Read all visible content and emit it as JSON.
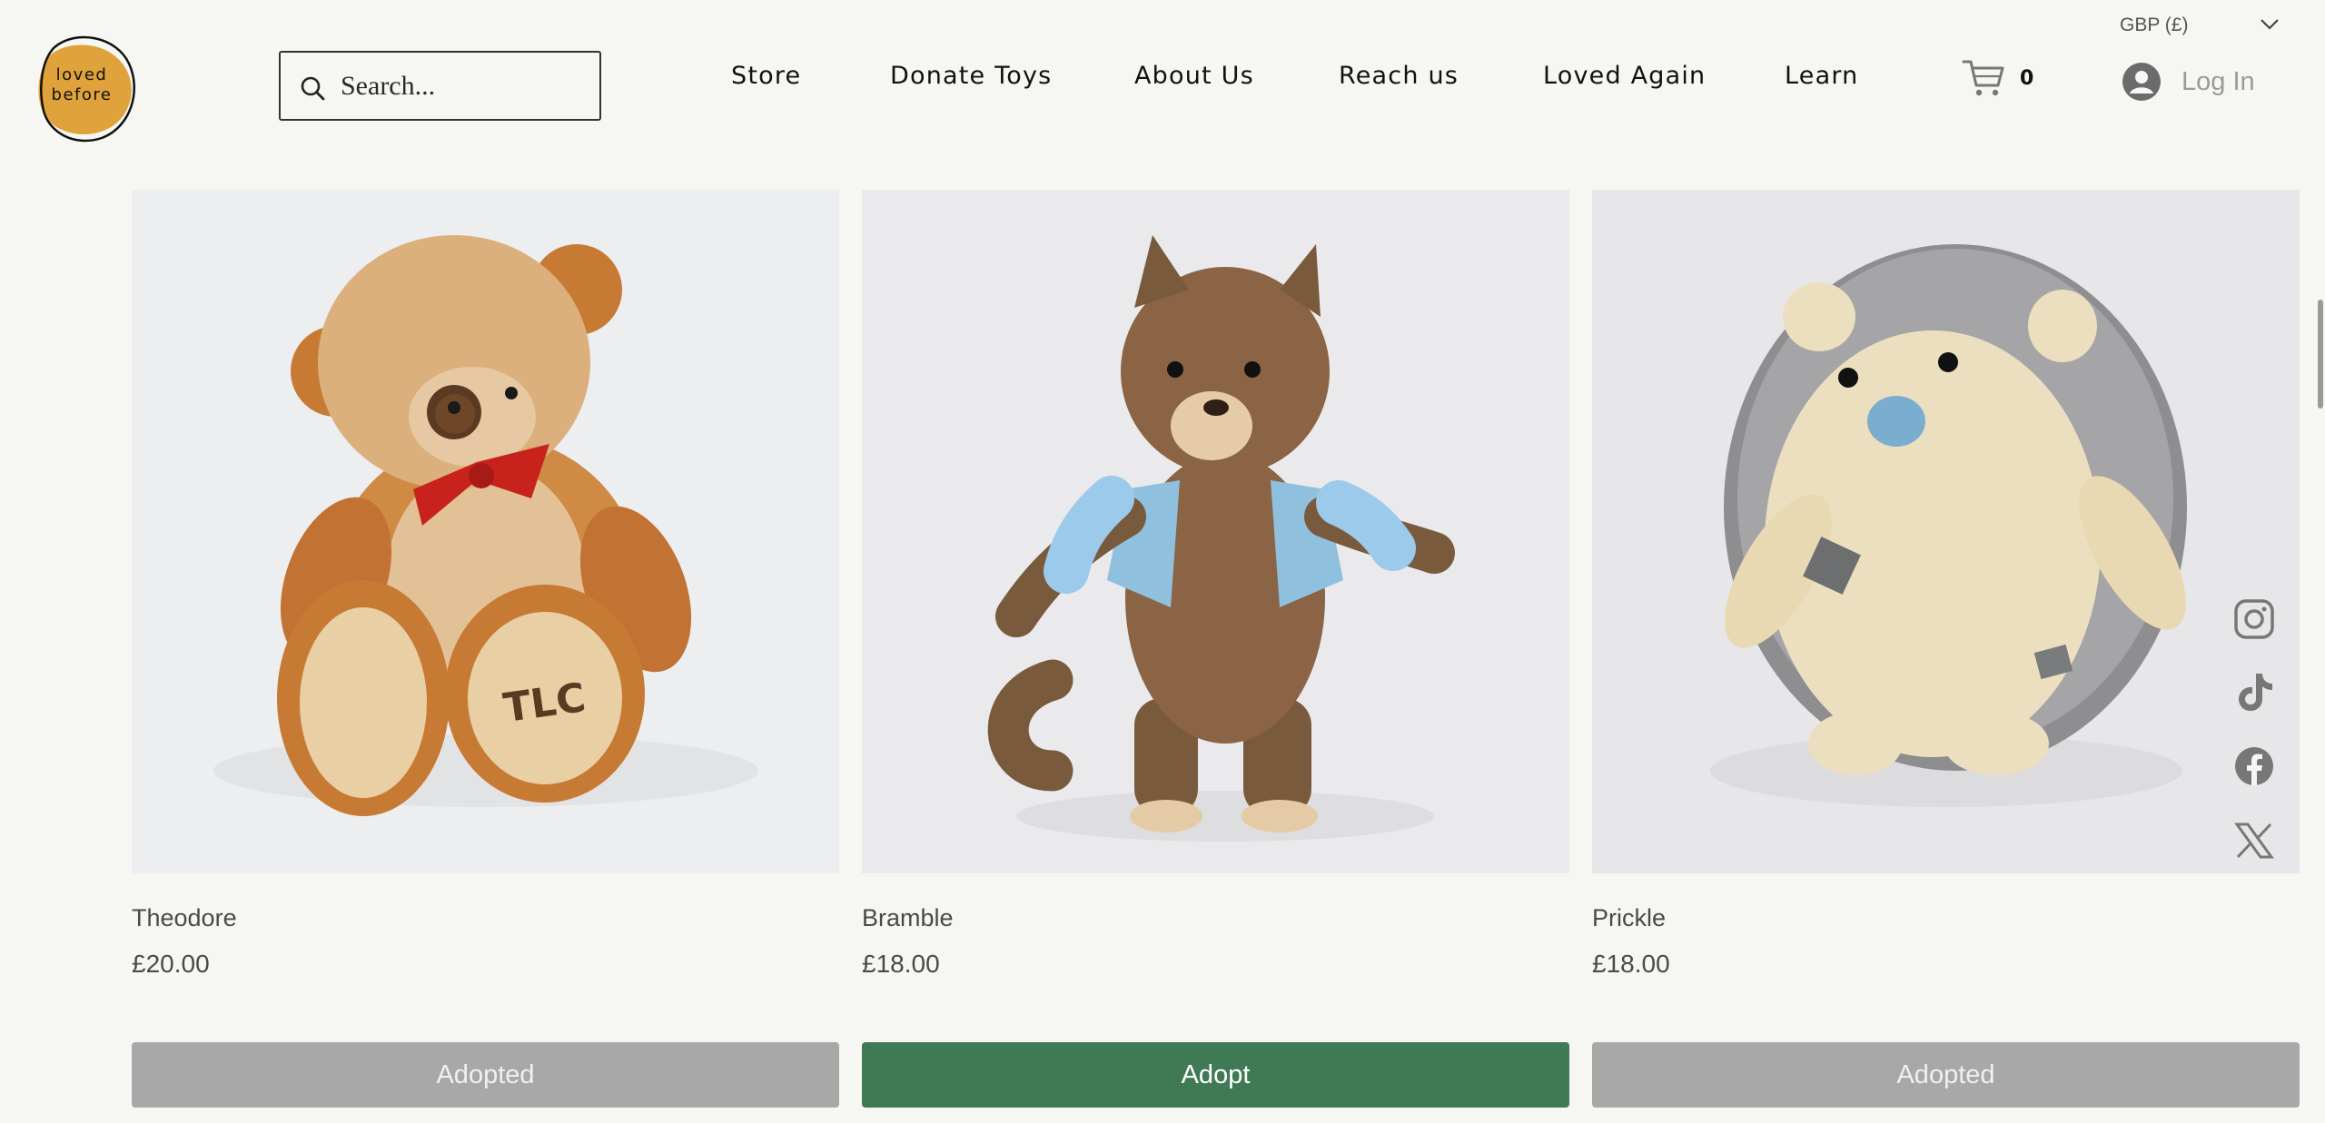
{
  "brand": {
    "logo_line1": "loved",
    "logo_line2": "before"
  },
  "search": {
    "placeholder": "Search..."
  },
  "nav": {
    "items": [
      {
        "label": "Store"
      },
      {
        "label": "Donate Toys"
      },
      {
        "label": "About Us"
      },
      {
        "label": "Reach us"
      },
      {
        "label": "Loved Again"
      },
      {
        "label": "Learn"
      }
    ]
  },
  "cart": {
    "count": "0"
  },
  "account": {
    "login_label": "Log In"
  },
  "currency": {
    "selected": "GBP (£)"
  },
  "products": [
    {
      "name": "Theodore",
      "price": "£20.00",
      "button": "Adopted",
      "status": "adopted"
    },
    {
      "name": "Bramble",
      "price": "£18.00",
      "button": "Adopt",
      "status": "available"
    },
    {
      "name": "Prickle",
      "price": "£18.00",
      "button": "Adopted",
      "status": "adopted"
    }
  ],
  "social": [
    "instagram-icon",
    "tiktok-icon",
    "facebook-icon",
    "x-icon"
  ],
  "colors": {
    "adopt": "#3f7a54",
    "adopted": "#a8a8a8",
    "logo": "#e0a23a",
    "background": "#f6f6f2"
  }
}
